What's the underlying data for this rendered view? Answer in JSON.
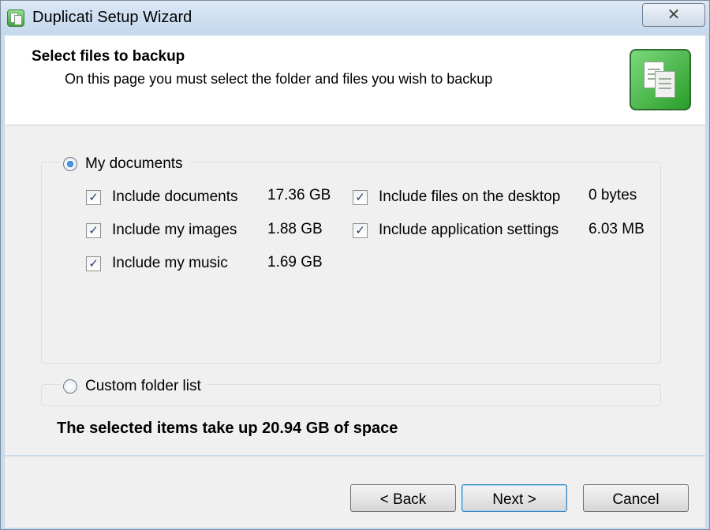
{
  "window": {
    "title": "Duplicati Setup Wizard",
    "close_label": "✕"
  },
  "header": {
    "title": "Select files to backup",
    "description": "On this page you must select the folder and files you wish to backup"
  },
  "options": {
    "my_documents": {
      "label": "My documents",
      "selected": true,
      "items": [
        {
          "label": "Include documents",
          "size": "17.36 GB",
          "checked": true
        },
        {
          "label": "Include my images",
          "size": "1.88 GB",
          "checked": true
        },
        {
          "label": "Include my music",
          "size": "1.69 GB",
          "checked": true
        },
        {
          "label": "Include files on the desktop",
          "size": "0 bytes",
          "checked": true
        },
        {
          "label": "Include application settings",
          "size": "6.03 MB",
          "checked": true
        }
      ]
    },
    "custom_folder": {
      "label": "Custom folder list",
      "selected": false
    }
  },
  "summary": "The selected items take up 20.94 GB of space",
  "buttons": {
    "back": "< Back",
    "next": "Next >",
    "cancel": "Cancel"
  },
  "check_glyph": "✓",
  "icons": {
    "app": "duplicati-icon",
    "header": "documents-icon"
  },
  "colors": {
    "accent": "#3aa23a",
    "title_bar": "#c9dbee"
  }
}
